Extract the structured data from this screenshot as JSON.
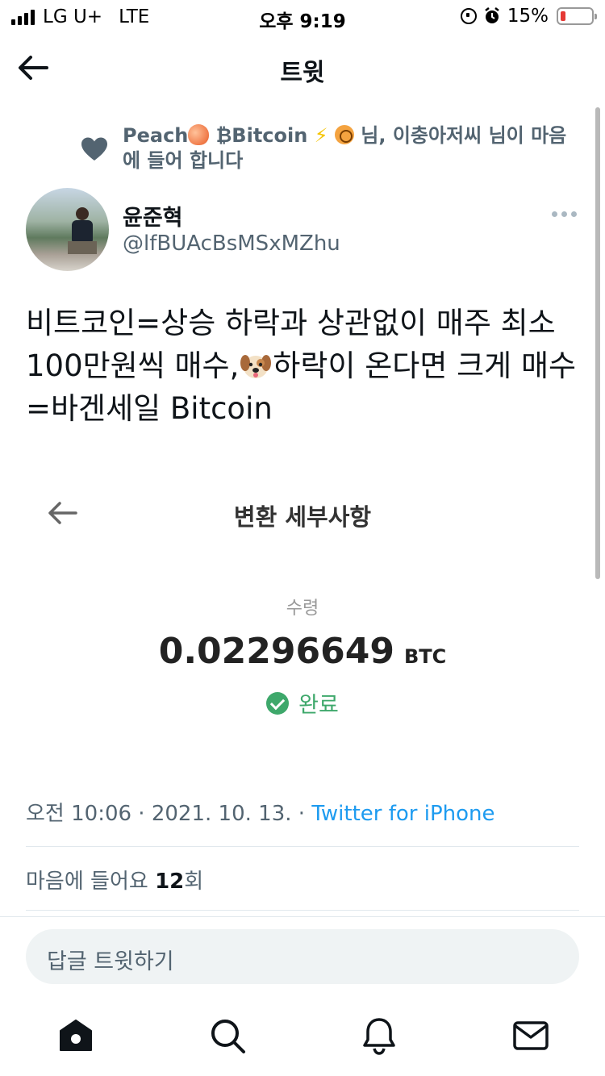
{
  "status_bar": {
    "carrier": "LG U+",
    "network": "LTE",
    "time": "오후 9:19",
    "battery": "15%",
    "battery_level": 0.15
  },
  "header": {
    "title": "트윗",
    "back_icon": "arrow-left-icon"
  },
  "social_context": {
    "name_part1": "Peach",
    "name_part2": "Bitcoin",
    "bitcoin_symbol": "₿",
    "text": "님, 이충아저씨 님이 마음에 들어 합니다",
    "icon": "heart-icon"
  },
  "author": {
    "name": "윤준혁",
    "handle": "@lfBUAcBsMSxMZhu"
  },
  "tweet": {
    "text_before": "비트코인=상승 하락과 상관없이 매주 최소 100만원씩 매수,",
    "text_after": "하락이 온다면 크게 매수=바겐세일 Bitcoin"
  },
  "embed": {
    "title": "변환 세부사항",
    "label": "수령",
    "amount": "0.02296649",
    "unit": "BTC",
    "status": "완료",
    "status_color": "#3ea86b"
  },
  "meta": {
    "time": "오전 10:06",
    "separator": " · ",
    "date": "2021. 10. 13.",
    "source": "Twitter for iPhone"
  },
  "likes": {
    "label": "마음에 들어요",
    "count": "12",
    "suffix": "회"
  },
  "reply": {
    "placeholder": "답글 트윗하기"
  },
  "tabbar": {
    "items": [
      "home-icon",
      "search-icon",
      "notifications-icon",
      "messages-icon"
    ]
  },
  "colors": {
    "text_primary": "#0f1419",
    "text_secondary": "#536471",
    "link": "#1d9bf0",
    "battery_low": "#e53935"
  }
}
